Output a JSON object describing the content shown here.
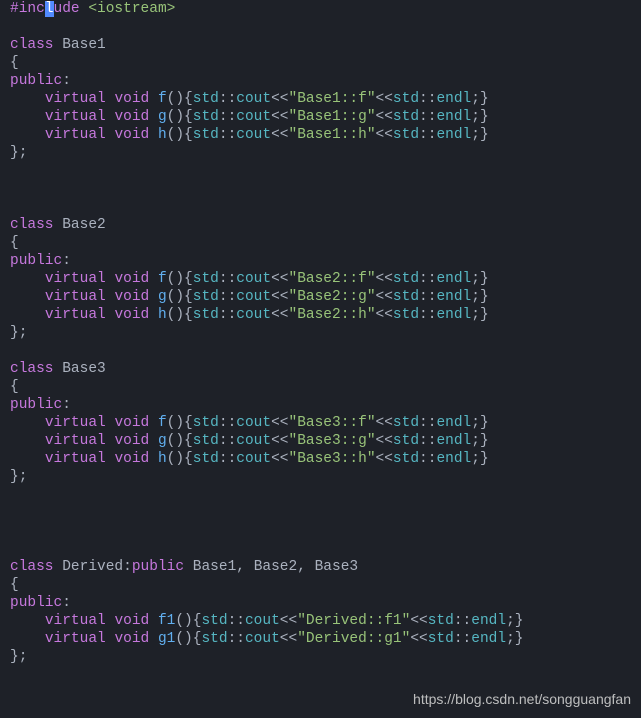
{
  "code": {
    "include_hash": "#inc",
    "include_cursor": "l",
    "include_rest": "ude",
    "include_target": "<iostream>",
    "class_kw": "class",
    "base1": "Base1",
    "base2": "Base2",
    "base3": "Base3",
    "derived": "Derived",
    "lbrace": "{",
    "rbrace": "};",
    "public": "public",
    "colon": ":",
    "virtual": "virtual",
    "void": "void",
    "f": "f",
    "g": "g",
    "h": "h",
    "f1": "f1",
    "g1": "g1",
    "parens_open": "(){",
    "std": "std",
    "dcolon": "::",
    "cout": "cout",
    "ltlt": "<<",
    "endl": "endl",
    "tail": ";}",
    "s_b1f": "\"Base1::f\"",
    "s_b1g": "\"Base1::g\"",
    "s_b1h": "\"Base1::h\"",
    "s_b2f": "\"Base2::f\"",
    "s_b2g": "\"Base2::g\"",
    "s_b2h": "\"Base2::h\"",
    "s_b3f": "\"Base3::f\"",
    "s_b3g": "\"Base3::g\"",
    "s_b3h": "\"Base3::h\"",
    "s_df1": "\"Derived::f1\"",
    "s_dg1": "\"Derived::g1\"",
    "inherit_sep": ", "
  },
  "watermark": "https://blog.csdn.net/songguangfan"
}
